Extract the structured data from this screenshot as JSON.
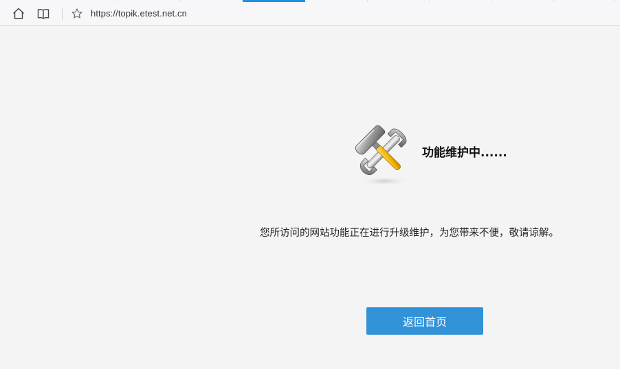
{
  "browser": {
    "url": "https://topik.etest.net.cn",
    "icons": {
      "home": "home-icon",
      "reading": "book-icon",
      "favorite": "star-icon"
    },
    "colors": {
      "active_tab": "#1e90e6"
    }
  },
  "page": {
    "graphic": "wrench-hammer-icon",
    "title": "功能维护中......",
    "message": "您所访问的网站功能正在进行升级维护，为您带来不便，敬请谅解。",
    "home_button_label": "返回首页",
    "colors": {
      "button": "#3292d8",
      "background": "#f4f4f4"
    }
  }
}
